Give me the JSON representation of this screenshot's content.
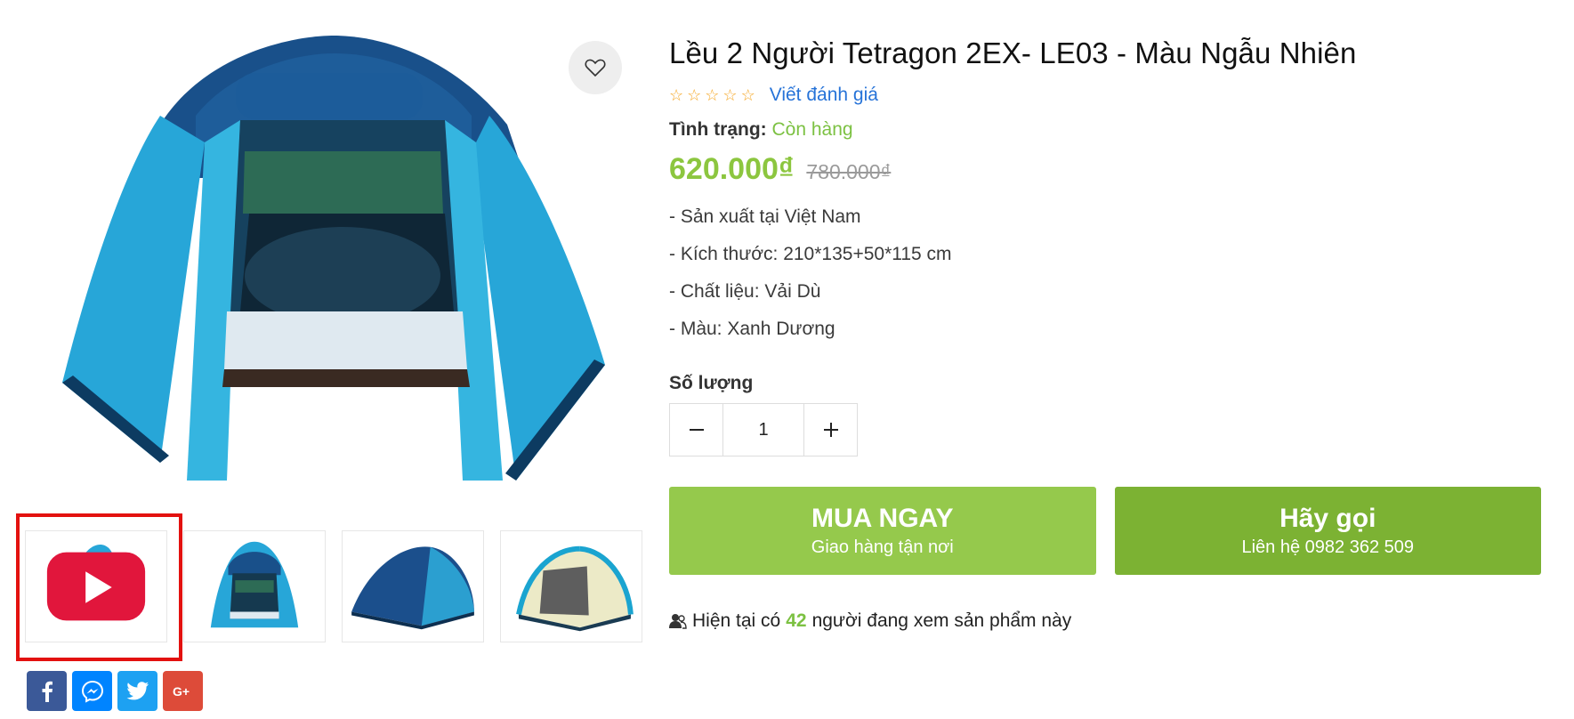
{
  "product": {
    "title": "Lều 2 Người Tetragon 2EX- LE03 - Màu Ngẫu Nhiên",
    "review_link": "Viết đánh giá",
    "rating": 0,
    "rating_max": 5,
    "status_label": "Tình trạng:",
    "status_value": "Còn hàng",
    "price": "620.000₫",
    "old_price": "780.000₫",
    "specs": [
      "- Sản xuất tại Việt Nam",
      "- Kích thước: 210*135+50*115 cm",
      "- Chất liệu: Vải Dù",
      "- Màu: Xanh Dương"
    ],
    "quantity_label": "Số lượng",
    "quantity_value": "1",
    "buy_button": {
      "main": "MUA NGAY",
      "sub": "Giao hàng tận nơi"
    },
    "call_button": {
      "main": "Hãy gọi",
      "sub": "Liên hệ 0982 362 509"
    },
    "viewers": {
      "prefix": "Hiện tại có",
      "count": "42",
      "suffix": "người đang xem sản phẩm này"
    }
  },
  "gallery": {
    "thumbnails": [
      {
        "name": "video-thumbnail",
        "icon": "youtube-play-icon"
      },
      {
        "name": "tent-front-view",
        "icon": "tent-image"
      },
      {
        "name": "tent-side-view",
        "icon": "tent-image"
      },
      {
        "name": "tent-inner-view",
        "icon": "tent-image"
      }
    ],
    "selected_index": 0
  },
  "share": [
    {
      "name": "facebook-icon",
      "color": "#3b5998"
    },
    {
      "name": "messenger-icon",
      "color": "#0084ff"
    },
    {
      "name": "twitter-icon",
      "color": "#1da1f2"
    },
    {
      "name": "google-plus-icon",
      "color": "#dd4b39"
    }
  ],
  "colors": {
    "accent_green": "#95c94c",
    "accent_green_dark": "#7cb233",
    "price_green": "#8cc63f",
    "link_blue": "#2673d8",
    "star_orange": "#f5a623",
    "selection_red": "#e3110f"
  }
}
